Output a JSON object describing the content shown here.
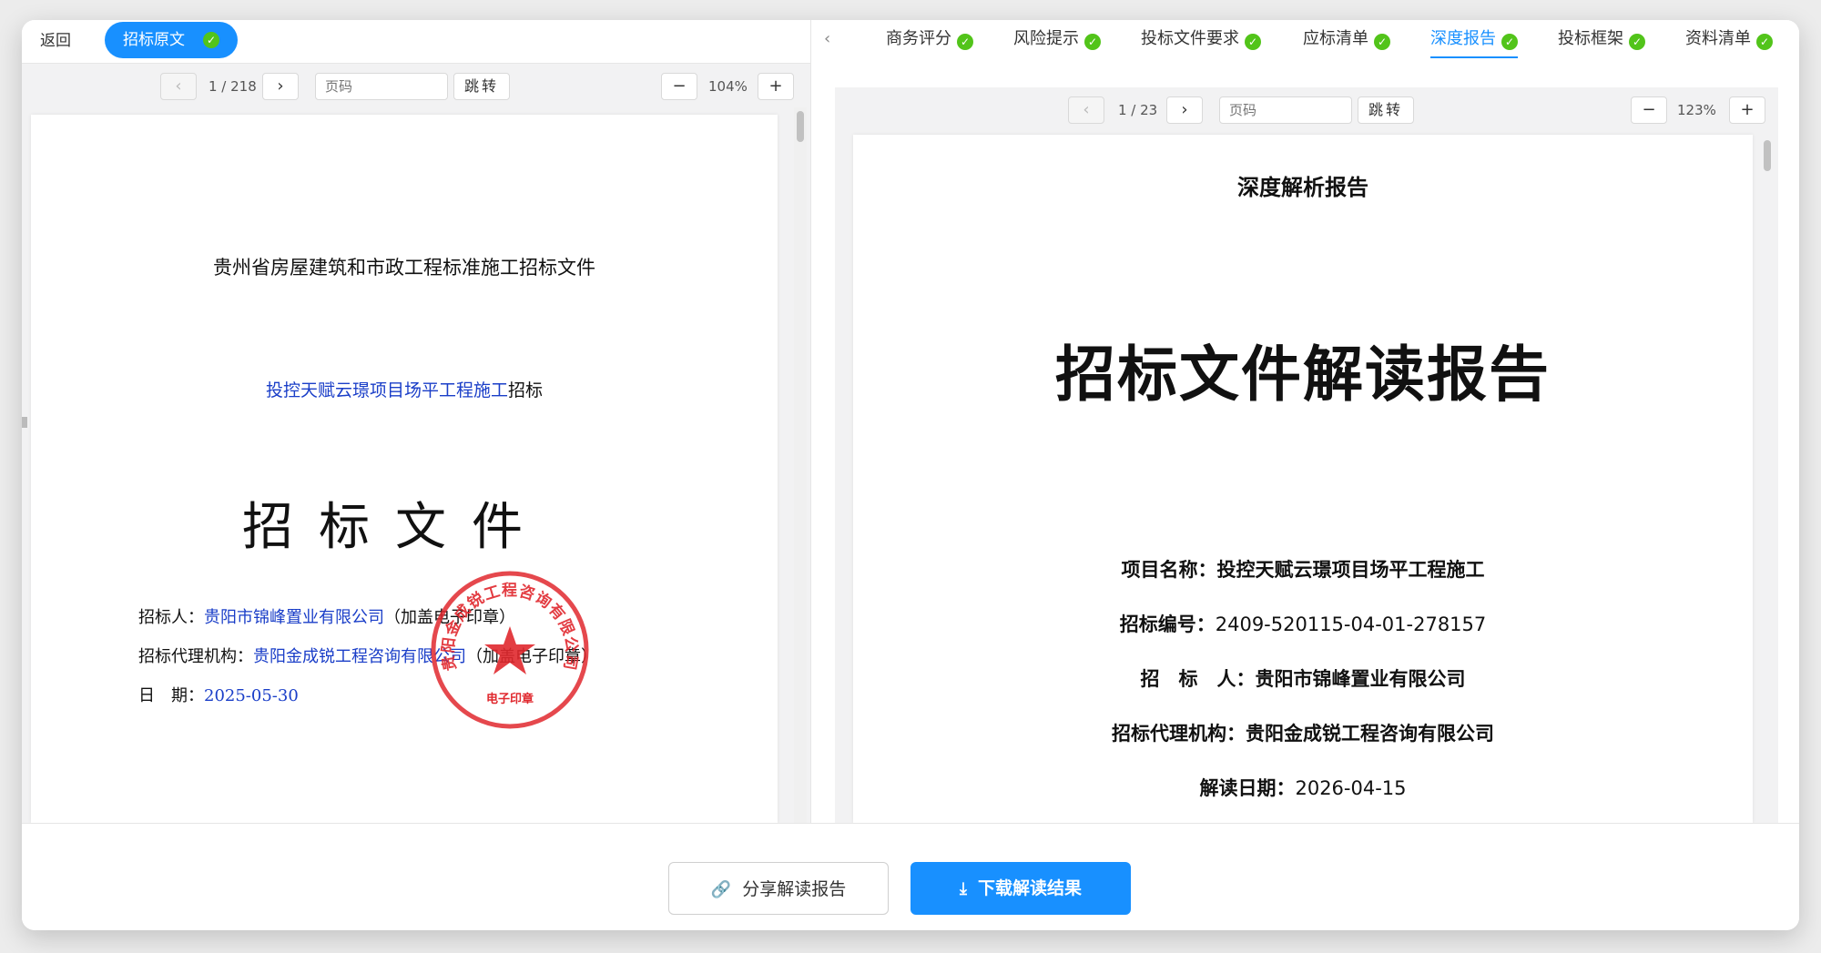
{
  "left": {
    "back_label": "返回",
    "pill_label": "招标原文",
    "toolbar": {
      "page_indicator": "1 / 218",
      "page_placeholder": "页码",
      "jump_label": "跳转",
      "zoom": "104%"
    },
    "document": {
      "line1": "贵州省房屋建筑和市政工程标准施工招标文件",
      "line2_project": "投控天赋云璟项目场平工程施工",
      "line2_suffix": "招标",
      "title": "招标文件",
      "tenderer_label": "招标人：",
      "tenderer_value": "贵阳市锦峰置业有限公司",
      "tenderer_note": "（加盖电子印章）",
      "agent_label": "招标代理机构：",
      "agent_value": "贵阳金成锐工程咨询有限公司",
      "agent_note": "（加盖电子印章）",
      "date_label": "日　期：",
      "date_value": "2025-05-30",
      "seal_text": "贵阳金成锐工程咨询有限公司",
      "seal_bottom": "电子印章"
    }
  },
  "right": {
    "tabs": [
      {
        "label": "商务评分"
      },
      {
        "label": "风险提示"
      },
      {
        "label": "投标文件要求"
      },
      {
        "label": "应标清单"
      },
      {
        "label": "深度报告"
      },
      {
        "label": "投标框架"
      },
      {
        "label": "资料清单"
      }
    ],
    "toolbar": {
      "page_indicator": "1 / 23",
      "page_placeholder": "页码",
      "jump_label": "跳转",
      "zoom": "123%"
    },
    "report": {
      "header": "深度解析报告",
      "title": "招标文件解读报告",
      "project_label": "项目名称：",
      "project_value": "投控天赋云璟项目场平工程施工",
      "code_label": "招标编号：",
      "code_value": "2409-520115-04-01-278157",
      "tenderer_label": "招　标　人：",
      "tenderer_value": "贵阳市锦峰置业有限公司",
      "agent_label": "招标代理机构：",
      "agent_value": "贵阳金成锐工程咨询有限公司",
      "date_label": "解读日期：",
      "date_value": "2026-04-15"
    }
  },
  "footer": {
    "share_label": "分享解读报告",
    "download_label": "下载解读结果"
  },
  "colors": {
    "accent": "#1890ff",
    "success": "#52c41a",
    "seal": "#e0282e",
    "link_text": "#1a3ec8"
  }
}
